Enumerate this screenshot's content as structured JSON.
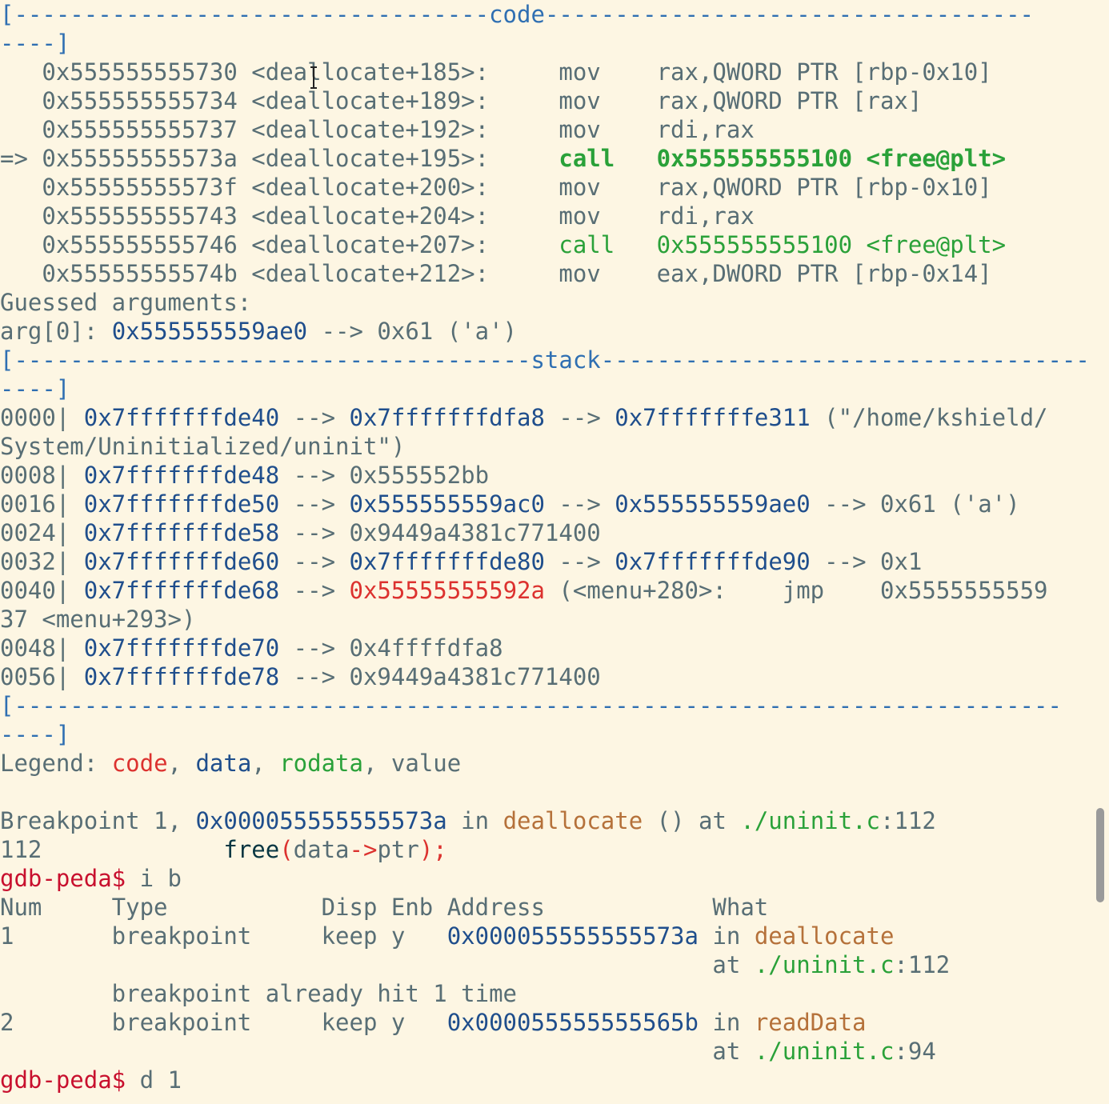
{
  "colors": {
    "background": "#fdf6e3",
    "text": "#586e75",
    "address": "#1f4e8c",
    "header": "#2f6fb2",
    "code_legend": "#dc322f",
    "rodata": "#2aa139",
    "function": "#b5713a",
    "prompt": "#c8102e"
  },
  "lines": [
    [
      {
        "t": "[----------------------------------",
        "c": "c-header"
      },
      {
        "t": "code",
        "c": "c-header"
      },
      {
        "t": "-----------------------------------",
        "c": "c-header"
      }
    ],
    [
      {
        "t": "----]",
        "c": "c-header"
      }
    ],
    [
      {
        "t": "   0x555555555730 <deallocate+185>:     mov    rax,QWORD PTR [rbp-0x10]",
        "c": "c-grey"
      }
    ],
    [
      {
        "t": "   0x555555555734 <deallocate+189>:     mov    rax,QWORD PTR [rax]",
        "c": "c-grey"
      }
    ],
    [
      {
        "t": "   0x555555555737 <deallocate+192>:     mov    rdi,rax",
        "c": "c-grey"
      }
    ],
    [
      {
        "t": "=> 0x55555555573a <deallocate+195>:     ",
        "c": "c-grey"
      },
      {
        "t": "call   0x555555555100 <free@plt>",
        "c": "c-green-b"
      }
    ],
    [
      {
        "t": "   0x55555555573f <deallocate+200>:     mov    rax,QWORD PTR [rbp-0x10]",
        "c": "c-grey"
      }
    ],
    [
      {
        "t": "   0x555555555743 <deallocate+204>:     mov    rdi,rax",
        "c": "c-grey"
      }
    ],
    [
      {
        "t": "   0x555555555746 <deallocate+207>:     ",
        "c": "c-grey"
      },
      {
        "t": "call   0x555555555100 <free@plt>",
        "c": "c-green"
      }
    ],
    [
      {
        "t": "   0x55555555574b <deallocate+212>:     mov    eax,DWORD PTR [rbp-0x14]",
        "c": "c-grey"
      }
    ],
    [
      {
        "t": "Guessed arguments:",
        "c": "c-grey"
      }
    ],
    [
      {
        "t": "arg[0]: ",
        "c": "c-grey"
      },
      {
        "t": "0x555555559ae0",
        "c": "c-blue"
      },
      {
        "t": " --> 0x61 ('a')",
        "c": "c-grey"
      }
    ],
    [
      {
        "t": "[-------------------------------------",
        "c": "c-header"
      },
      {
        "t": "stack",
        "c": "c-header"
      },
      {
        "t": "-------------------------------------",
        "c": "c-header"
      }
    ],
    [
      {
        "t": "----]",
        "c": "c-header"
      }
    ],
    [
      {
        "t": "0000| ",
        "c": "c-grey"
      },
      {
        "t": "0x7fffffffde40",
        "c": "c-blue"
      },
      {
        "t": " --> ",
        "c": "c-grey"
      },
      {
        "t": "0x7fffffffdfa8",
        "c": "c-blue"
      },
      {
        "t": " --> ",
        "c": "c-grey"
      },
      {
        "t": "0x7fffffffe311",
        "c": "c-blue"
      },
      {
        "t": " (\"/home/kshield/",
        "c": "c-grey"
      }
    ],
    [
      {
        "t": "System/Uninitialized/uninit\")",
        "c": "c-grey"
      }
    ],
    [
      {
        "t": "0008| ",
        "c": "c-grey"
      },
      {
        "t": "0x7fffffffde48",
        "c": "c-blue"
      },
      {
        "t": " --> 0x555552bb",
        "c": "c-grey"
      }
    ],
    [
      {
        "t": "0016| ",
        "c": "c-grey"
      },
      {
        "t": "0x7fffffffde50",
        "c": "c-blue"
      },
      {
        "t": " --> ",
        "c": "c-grey"
      },
      {
        "t": "0x555555559ac0",
        "c": "c-blue"
      },
      {
        "t": " --> ",
        "c": "c-grey"
      },
      {
        "t": "0x555555559ae0",
        "c": "c-blue"
      },
      {
        "t": " --> 0x61 ('a')",
        "c": "c-grey"
      }
    ],
    [
      {
        "t": "0024| ",
        "c": "c-grey"
      },
      {
        "t": "0x7fffffffde58",
        "c": "c-blue"
      },
      {
        "t": " --> 0x9449a4381c771400",
        "c": "c-grey"
      }
    ],
    [
      {
        "t": "0032| ",
        "c": "c-grey"
      },
      {
        "t": "0x7fffffffde60",
        "c": "c-blue"
      },
      {
        "t": " --> ",
        "c": "c-grey"
      },
      {
        "t": "0x7fffffffde80",
        "c": "c-blue"
      },
      {
        "t": " --> ",
        "c": "c-grey"
      },
      {
        "t": "0x7fffffffde90",
        "c": "c-blue"
      },
      {
        "t": " --> 0x1",
        "c": "c-grey"
      }
    ],
    [
      {
        "t": "0040| ",
        "c": "c-grey"
      },
      {
        "t": "0x7fffffffde68",
        "c": "c-blue"
      },
      {
        "t": " --> ",
        "c": "c-grey"
      },
      {
        "t": "0x55555555592a",
        "c": "c-red"
      },
      {
        "t": " (<menu+280>:    jmp    0x5555555559",
        "c": "c-grey"
      }
    ],
    [
      {
        "t": "37 <menu+293>)",
        "c": "c-grey"
      }
    ],
    [
      {
        "t": "0048| ",
        "c": "c-grey"
      },
      {
        "t": "0x7fffffffde70",
        "c": "c-blue"
      },
      {
        "t": " --> 0x4ffffdfa8",
        "c": "c-grey"
      }
    ],
    [
      {
        "t": "0056| ",
        "c": "c-grey"
      },
      {
        "t": "0x7fffffffde78",
        "c": "c-blue"
      },
      {
        "t": " --> 0x9449a4381c771400",
        "c": "c-grey"
      }
    ],
    [
      {
        "t": "[---------------------------------------------------------------------------",
        "c": "c-header"
      }
    ],
    [
      {
        "t": "----]",
        "c": "c-header"
      }
    ],
    [
      {
        "t": "Legend: ",
        "c": "c-grey"
      },
      {
        "t": "code",
        "c": "c-red"
      },
      {
        "t": ", ",
        "c": "c-grey"
      },
      {
        "t": "data",
        "c": "c-blue"
      },
      {
        "t": ", ",
        "c": "c-grey"
      },
      {
        "t": "rodata",
        "c": "c-green"
      },
      {
        "t": ", value",
        "c": "c-grey"
      }
    ],
    [
      {
        "t": "",
        "c": "c-grey"
      }
    ],
    [
      {
        "t": "Breakpoint 1, ",
        "c": "c-grey"
      },
      {
        "t": "0x000055555555573a",
        "c": "c-blue"
      },
      {
        "t": " in ",
        "c": "c-grey"
      },
      {
        "t": "deallocate",
        "c": "c-orange"
      },
      {
        "t": " () at ",
        "c": "c-grey"
      },
      {
        "t": "./uninit.c",
        "c": "c-green"
      },
      {
        "t": ":112",
        "c": "c-grey"
      }
    ],
    [
      {
        "t": "112             ",
        "c": "c-grey"
      },
      {
        "t": "free",
        "c": "c-dark"
      },
      {
        "t": "(",
        "c": "c-red"
      },
      {
        "t": "data",
        "c": "c-grey"
      },
      {
        "t": "->",
        "c": "c-red"
      },
      {
        "t": "ptr",
        "c": "c-grey"
      },
      {
        "t": ");",
        "c": "c-red"
      }
    ],
    [
      {
        "t": "gdb-peda$ ",
        "c": "c-prompt"
      },
      {
        "t": "i b",
        "c": "c-grey"
      }
    ],
    [
      {
        "t": "Num     Type           Disp Enb Address            What",
        "c": "c-grey"
      }
    ],
    [
      {
        "t": "1       breakpoint     keep y   ",
        "c": "c-grey"
      },
      {
        "t": "0x000055555555573a",
        "c": "c-blue"
      },
      {
        "t": " in ",
        "c": "c-grey"
      },
      {
        "t": "deallocate",
        "c": "c-orange"
      }
    ],
    [
      {
        "t": "                                                   at ",
        "c": "c-grey"
      },
      {
        "t": "./uninit.c",
        "c": "c-green"
      },
      {
        "t": ":112",
        "c": "c-grey"
      }
    ],
    [
      {
        "t": "        breakpoint already hit 1 time",
        "c": "c-grey"
      }
    ],
    [
      {
        "t": "2       breakpoint     keep y   ",
        "c": "c-grey"
      },
      {
        "t": "0x000055555555565b",
        "c": "c-blue"
      },
      {
        "t": " in ",
        "c": "c-grey"
      },
      {
        "t": "readData",
        "c": "c-orange"
      }
    ],
    [
      {
        "t": "                                                   at ",
        "c": "c-grey"
      },
      {
        "t": "./uninit.c",
        "c": "c-green"
      },
      {
        "t": ":94",
        "c": "c-grey"
      }
    ],
    [
      {
        "t": "gdb-peda$ ",
        "c": "c-prompt"
      },
      {
        "t": "d 1",
        "c": "c-grey"
      }
    ]
  ]
}
